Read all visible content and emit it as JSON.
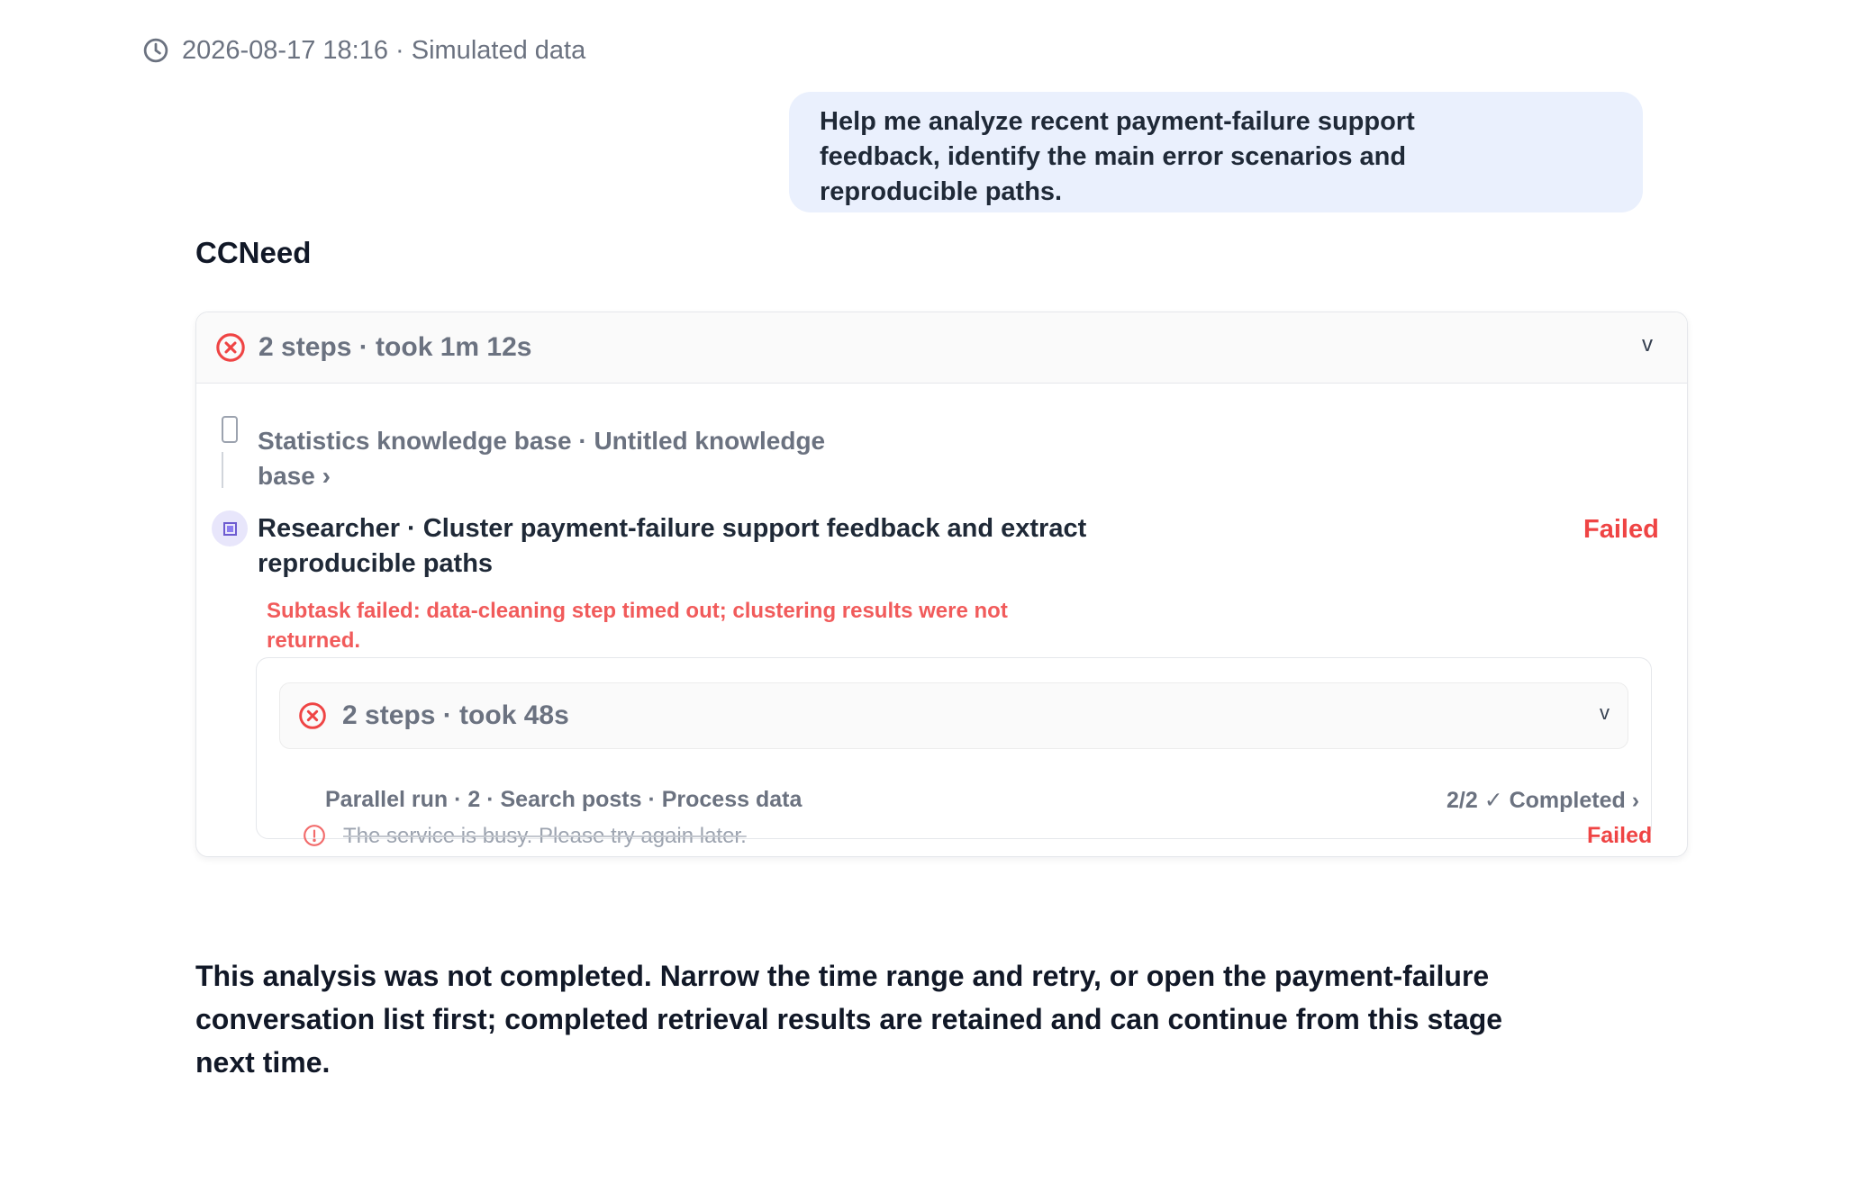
{
  "timestamp": {
    "icon": "clock-icon",
    "text": "2026-08-17 18:16 · Simulated data"
  },
  "user_message": "Help me analyze recent payment-failure support feedback, identify the main error scenarios and reproducible paths.",
  "assistant_name": "CCNeed",
  "run": {
    "status_icon": "x-circle-icon",
    "summary": "2 steps · took 1m 12s",
    "toggle": "v",
    "steps": [
      {
        "icon": "document-icon",
        "label": "Statistics knowledge base · Untitled knowledge base ›"
      },
      {
        "icon": "researcher-icon",
        "label": "Researcher · Cluster payment-failure support feedback and extract reproducible paths",
        "status": "Failed",
        "error": "Subtask failed: data-cleaning step timed out; clustering results were not returned.",
        "subrun": {
          "status_icon": "x-circle-icon",
          "summary": "2 steps · took 48s",
          "toggle": "v",
          "parallel_label": "Parallel run · 2 · Search posts · Process data",
          "parallel_status": "2/2 ✓ Completed ›",
          "warning_icon": "alert-circle-icon",
          "warning_text": "The service is busy. Please try again later.",
          "warning_status": "Failed"
        }
      }
    ]
  },
  "final_summary": "This analysis was not completed. Narrow the time range and retry, or open the payment-failure conversation list first; completed retrieval results are retained and can continue from this stage next time.",
  "colors": {
    "error": "#ef4444",
    "muted": "#6b7280",
    "bubble": "#eaf0fd",
    "accent": "#6d5bd0"
  }
}
